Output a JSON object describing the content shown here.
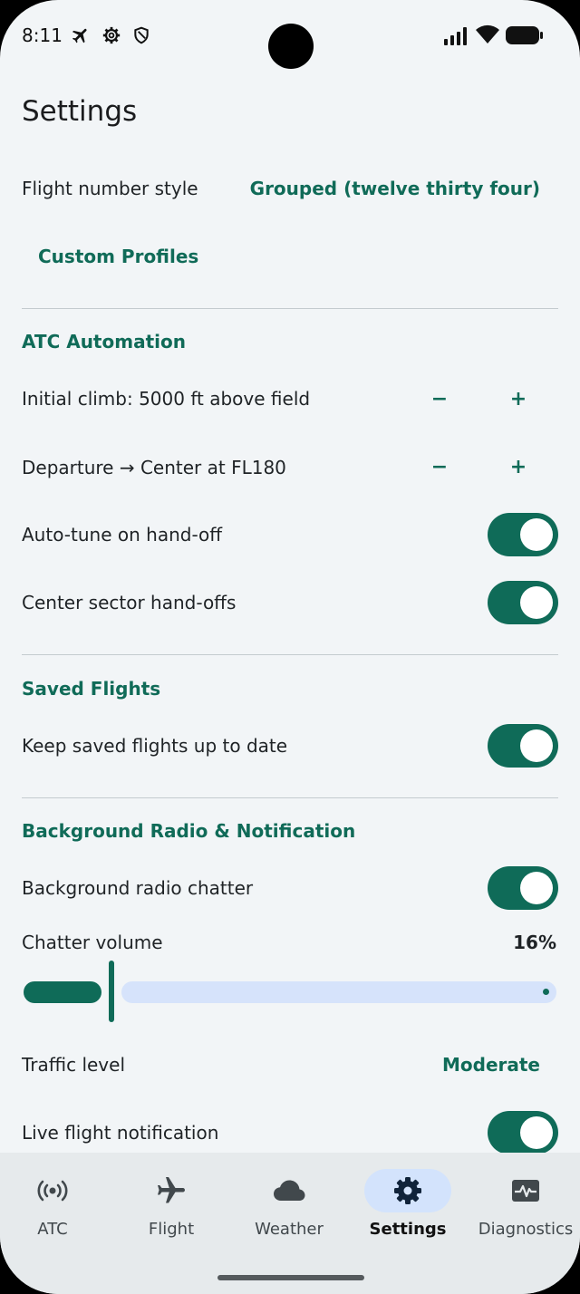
{
  "status_bar": {
    "time": "8:11",
    "icons": [
      "airplane-icon",
      "gear-icon",
      "shield-icon",
      "signal-icon",
      "wifi-icon",
      "battery-icon"
    ]
  },
  "page": {
    "title": "Settings"
  },
  "general": {
    "flight_number_style_label": "Flight number style",
    "flight_number_style_value": "Grouped (twelve thirty four)",
    "custom_profiles_label": "Custom Profiles"
  },
  "atc_automation": {
    "header": "ATC Automation",
    "initial_climb_label": "Initial climb: 5000 ft above field",
    "departure_label": "Departure → Center at FL180",
    "minus_label": "−",
    "plus_label": "+",
    "auto_tune_label": "Auto-tune on hand-off",
    "auto_tune_on": true,
    "center_handoffs_label": "Center sector hand-offs",
    "center_handoffs_on": true
  },
  "saved_flights": {
    "header": "Saved Flights",
    "keep_updated_label": "Keep saved flights up to date",
    "keep_updated_on": true
  },
  "background": {
    "header": "Background Radio & Notification",
    "chatter_label": "Background radio chatter",
    "chatter_on": true,
    "volume_label": "Chatter volume",
    "volume_value": "16%",
    "volume_fraction": 0.16,
    "traffic_label": "Traffic level",
    "traffic_value": "Moderate",
    "live_notification_label": "Live flight notification",
    "live_notification_on": true
  },
  "nav": {
    "items": [
      {
        "label": "ATC",
        "icon": "radio-waves-icon",
        "active": false
      },
      {
        "label": "Flight",
        "icon": "airplane-icon",
        "active": false
      },
      {
        "label": "Weather",
        "icon": "cloud-icon",
        "active": false
      },
      {
        "label": "Settings",
        "icon": "gear-icon",
        "active": true
      },
      {
        "label": "Diagnostics",
        "icon": "monitor-heart-icon",
        "active": false
      }
    ]
  },
  "colors": {
    "accent": "#106b58",
    "background": "#f2f5f7",
    "nav_background": "#e6eaec",
    "active_pill": "#d3e3fc",
    "slider_inactive": "#d6e3fb"
  }
}
